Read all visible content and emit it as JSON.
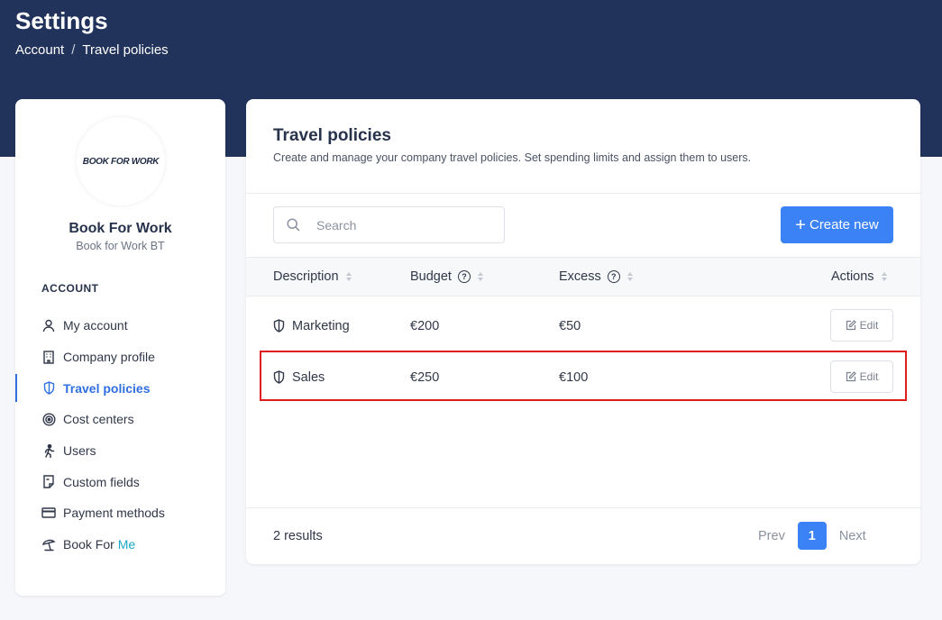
{
  "header": {
    "title": "Settings",
    "breadcrumb": [
      "Account",
      "Travel policies"
    ]
  },
  "sidebar": {
    "logo_text": "BOOK FOR WORK",
    "company_name": "Book For Work",
    "company_subtitle": "Book for Work BT",
    "section_label": "ACCOUNT",
    "items": [
      {
        "label": "My account",
        "icon": "user-icon",
        "active": false
      },
      {
        "label": "Company profile",
        "icon": "building-icon",
        "active": false
      },
      {
        "label": "Travel policies",
        "icon": "shield-icon",
        "active": true
      },
      {
        "label": "Cost centers",
        "icon": "target-icon",
        "active": false
      },
      {
        "label": "Users",
        "icon": "walking-user-icon",
        "active": false
      },
      {
        "label": "Custom fields",
        "icon": "document-icon",
        "active": false
      },
      {
        "label": "Payment methods",
        "icon": "credit-card-icon",
        "active": false
      },
      {
        "label_main": "Book For ",
        "label_accent": "Me",
        "icon": "beach-umbrella-icon",
        "active": false
      }
    ]
  },
  "main": {
    "title": "Travel policies",
    "description": "Create and manage your company travel policies. Set spending limits and assign them to users.",
    "search_placeholder": "Search",
    "create_label": "Create new",
    "columns": {
      "description": "Description",
      "budget": "Budget",
      "excess": "Excess",
      "actions": "Actions"
    },
    "rows": [
      {
        "description": "Marketing",
        "budget": "€200",
        "excess": "€50",
        "action": "Edit"
      },
      {
        "description": "Sales",
        "budget": "€250",
        "excess": "€100",
        "action": "Edit"
      }
    ],
    "results": "2 results",
    "pagination": {
      "prev": "Prev",
      "current": "1",
      "next": "Next"
    }
  },
  "colors": {
    "header_bg": "#22335b",
    "primary": "#3b82f6",
    "active_nav": "#2f6fe0",
    "accent": "#19a7c8",
    "highlight_border": "#dd1c1c"
  }
}
